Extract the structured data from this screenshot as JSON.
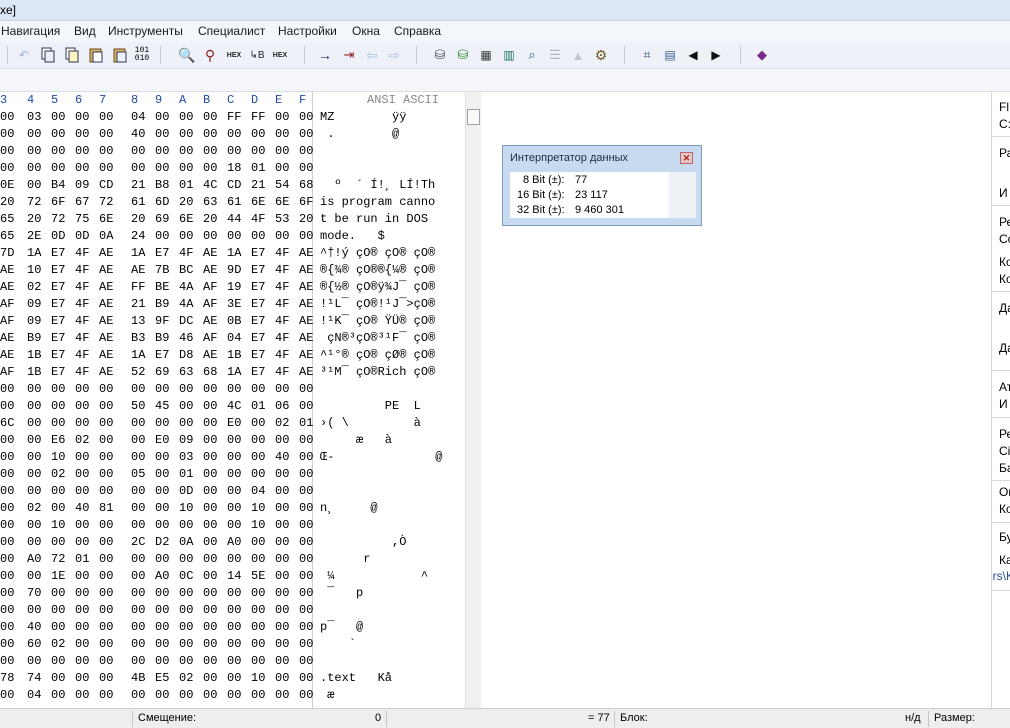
{
  "window": {
    "title_fragment": "xe]"
  },
  "menu": [
    "Навигация",
    "Вид",
    "Инструменты",
    "Специалист",
    "Настройки",
    "Окна",
    "Справка"
  ],
  "toolbar_icons": [
    "undo-icon",
    "copy-icon",
    "copy-hex-icon",
    "paste-icon",
    "paste-hex-icon",
    "binary-icon",
    "find-icon",
    "find-replace-icon",
    "find-hex-icon",
    "replace-hex-icon",
    "find-next-hex-icon",
    "goto-offset-icon",
    "goto-sector-icon",
    "back-icon",
    "forward-icon",
    "disk-icon",
    "open-disk-icon",
    "ram-icon",
    "calculator-icon",
    "magnifier-icon",
    "script-icon",
    "gear-icon",
    "bookmark-icon",
    "toggle-icon",
    "prev-icon",
    "next-icon",
    "book-icon"
  ],
  "hex": {
    "columns": [
      "3",
      "4",
      "5",
      "6",
      "7",
      "8",
      "9",
      "A",
      "B",
      "C",
      "D",
      "E",
      "F"
    ],
    "ansi_header": "ANSI ASCII",
    "rows": [
      [
        "00",
        "03",
        "00",
        "00",
        "00",
        "04",
        "00",
        "00",
        "00",
        "FF",
        "FF",
        "00",
        "00"
      ],
      [
        "00",
        "00",
        "00",
        "00",
        "00",
        "40",
        "00",
        "00",
        "00",
        "00",
        "00",
        "00",
        "00"
      ],
      [
        "00",
        "00",
        "00",
        "00",
        "00",
        "00",
        "00",
        "00",
        "00",
        "00",
        "00",
        "00",
        "00"
      ],
      [
        "00",
        "00",
        "00",
        "00",
        "00",
        "00",
        "00",
        "00",
        "00",
        "18",
        "01",
        "00",
        "00"
      ],
      [
        "0E",
        "00",
        "B4",
        "09",
        "CD",
        "21",
        "B8",
        "01",
        "4C",
        "CD",
        "21",
        "54",
        "68"
      ],
      [
        "20",
        "72",
        "6F",
        "67",
        "72",
        "61",
        "6D",
        "20",
        "63",
        "61",
        "6E",
        "6E",
        "6F"
      ],
      [
        "65",
        "20",
        "72",
        "75",
        "6E",
        "20",
        "69",
        "6E",
        "20",
        "44",
        "4F",
        "53",
        "20"
      ],
      [
        "65",
        "2E",
        "0D",
        "0D",
        "0A",
        "24",
        "00",
        "00",
        "00",
        "00",
        "00",
        "00",
        "00"
      ],
      [
        "7D",
        "1A",
        "E7",
        "4F",
        "AE",
        "1A",
        "E7",
        "4F",
        "AE",
        "1A",
        "E7",
        "4F",
        "AE"
      ],
      [
        "AE",
        "10",
        "E7",
        "4F",
        "AE",
        "AE",
        "7B",
        "BC",
        "AE",
        "9D",
        "E7",
        "4F",
        "AE"
      ],
      [
        "AE",
        "02",
        "E7",
        "4F",
        "AE",
        "FF",
        "BE",
        "4A",
        "AF",
        "19",
        "E7",
        "4F",
        "AE"
      ],
      [
        "AF",
        "09",
        "E7",
        "4F",
        "AE",
        "21",
        "B9",
        "4A",
        "AF",
        "3E",
        "E7",
        "4F",
        "AE"
      ],
      [
        "AF",
        "09",
        "E7",
        "4F",
        "AE",
        "13",
        "9F",
        "DC",
        "AE",
        "0B",
        "E7",
        "4F",
        "AE"
      ],
      [
        "AE",
        "B9",
        "E7",
        "4F",
        "AE",
        "B3",
        "B9",
        "46",
        "AF",
        "04",
        "E7",
        "4F",
        "AE"
      ],
      [
        "AE",
        "1B",
        "E7",
        "4F",
        "AE",
        "1A",
        "E7",
        "D8",
        "AE",
        "1B",
        "E7",
        "4F",
        "AE"
      ],
      [
        "AF",
        "1B",
        "E7",
        "4F",
        "AE",
        "52",
        "69",
        "63",
        "68",
        "1A",
        "E7",
        "4F",
        "AE"
      ],
      [
        "00",
        "00",
        "00",
        "00",
        "00",
        "00",
        "00",
        "00",
        "00",
        "00",
        "00",
        "00",
        "00"
      ],
      [
        "00",
        "00",
        "00",
        "00",
        "00",
        "50",
        "45",
        "00",
        "00",
        "4C",
        "01",
        "06",
        "00"
      ],
      [
        "6C",
        "00",
        "00",
        "00",
        "00",
        "00",
        "00",
        "00",
        "00",
        "E0",
        "00",
        "02",
        "01"
      ],
      [
        "00",
        "00",
        "E6",
        "02",
        "00",
        "00",
        "E0",
        "09",
        "00",
        "00",
        "00",
        "00",
        "00"
      ],
      [
        "00",
        "00",
        "10",
        "00",
        "00",
        "00",
        "00",
        "03",
        "00",
        "00",
        "00",
        "40",
        "00"
      ],
      [
        "00",
        "00",
        "02",
        "00",
        "00",
        "05",
        "00",
        "01",
        "00",
        "00",
        "00",
        "00",
        "00"
      ],
      [
        "00",
        "00",
        "00",
        "00",
        "00",
        "00",
        "00",
        "0D",
        "00",
        "00",
        "04",
        "00",
        "00"
      ],
      [
        "00",
        "02",
        "00",
        "40",
        "81",
        "00",
        "00",
        "10",
        "00",
        "00",
        "10",
        "00",
        "00"
      ],
      [
        "00",
        "00",
        "10",
        "00",
        "00",
        "00",
        "00",
        "00",
        "00",
        "00",
        "10",
        "00",
        "00"
      ],
      [
        "00",
        "00",
        "00",
        "00",
        "00",
        "2C",
        "D2",
        "0A",
        "00",
        "A0",
        "00",
        "00",
        "00"
      ],
      [
        "00",
        "A0",
        "72",
        "01",
        "00",
        "00",
        "00",
        "00",
        "00",
        "00",
        "00",
        "00",
        "00"
      ],
      [
        "00",
        "00",
        "1E",
        "00",
        "00",
        "00",
        "A0",
        "0C",
        "00",
        "14",
        "5E",
        "00",
        "00"
      ],
      [
        "00",
        "70",
        "00",
        "00",
        "00",
        "00",
        "00",
        "00",
        "00",
        "00",
        "00",
        "00",
        "00"
      ],
      [
        "00",
        "00",
        "00",
        "00",
        "00",
        "00",
        "00",
        "00",
        "00",
        "00",
        "00",
        "00",
        "00"
      ],
      [
        "00",
        "40",
        "00",
        "00",
        "00",
        "00",
        "00",
        "00",
        "00",
        "00",
        "00",
        "00",
        "00"
      ],
      [
        "00",
        "60",
        "02",
        "00",
        "00",
        "00",
        "00",
        "00",
        "00",
        "00",
        "00",
        "00",
        "00"
      ],
      [
        "00",
        "00",
        "00",
        "00",
        "00",
        "00",
        "00",
        "00",
        "00",
        "00",
        "00",
        "00",
        "00"
      ],
      [
        "78",
        "74",
        "00",
        "00",
        "00",
        "4B",
        "E5",
        "02",
        "00",
        "00",
        "10",
        "00",
        "00"
      ],
      [
        "00",
        "04",
        "00",
        "00",
        "00",
        "00",
        "00",
        "00",
        "00",
        "00",
        "00",
        "00",
        "00"
      ]
    ],
    "ansi": [
      "MZ        ÿÿ",
      " .        @",
      "",
      "",
      "  º  ´ Í!¸ LÍ!Th",
      "is program canno",
      "t be run in DOS",
      "mode.   $",
      "^†!ý çO® çO® çO®",
      "®{¾® çO®®{¼® çO®",
      "®{½® çO®ÿ¾J¯ çO®",
      "!¹L¯ çO®!¹J¯>çO®",
      "!¹K¯ çO® ŸÜ® çO®",
      " çN®³çO®³¹F¯ çO®",
      "^¹°® çO® çØ® çO®",
      "³¹M¯ çO®Rich çO®",
      "",
      "         PE  L",
      "›( \\         à",
      "     æ   à",
      "Œ-              @",
      "",
      "",
      "n¸     @",
      "",
      "          ,Ò",
      "      r",
      " ¼            ^",
      " ¯   p",
      "",
      "p¯   @",
      "    `",
      "",
      ".text   Kå",
      " æ"
    ]
  },
  "interpreter": {
    "title": "Интерпретатор данных",
    "rows": [
      {
        "label": "8 Bit (±):",
        "value": "77"
      },
      {
        "label": "16 Bit (±):",
        "value": "23 117"
      },
      {
        "label": "32 Bit (±):",
        "value": "9 460 301"
      }
    ]
  },
  "right_panel": [
    "Fl",
    "C:",
    "Ра",
    "И",
    "Ре",
    "Co",
    "Ко",
    "Ко",
    "Да",
    "Да",
    "Ат",
    "И",
    "Ре",
    "Ci",
    "Ба",
    "Or",
    "Ко",
    "Бу",
    "Ка",
    "ers\\K"
  ],
  "status": {
    "offset_label": "Смещение:",
    "offset_value": "0",
    "equals_value": "= 77",
    "block_label": "Блок:",
    "na_value": "н/д",
    "size_label": "Размер:"
  }
}
